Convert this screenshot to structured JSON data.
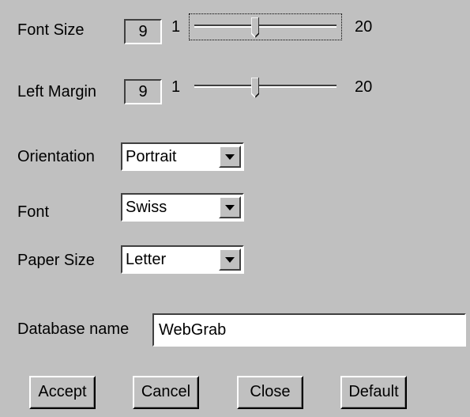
{
  "font_size": {
    "label": "Font Size",
    "value": "9",
    "min_label": "1",
    "max_label": "20",
    "level": 9,
    "min": 1,
    "max": 20
  },
  "left_margin": {
    "label": "Left Margin",
    "value": "9",
    "min_label": "1",
    "max_label": "20",
    "level": 9,
    "min": 1,
    "max": 20
  },
  "orientation": {
    "label": "Orientation",
    "selected": "Portrait"
  },
  "font": {
    "label": "Font",
    "selected": "Swiss"
  },
  "paper_size": {
    "label": "Paper Size",
    "selected": "Letter"
  },
  "database": {
    "label": "Database name",
    "value": "WebGrab"
  },
  "buttons": {
    "accept": "Accept",
    "cancel": "Cancel",
    "close": "Close",
    "default": "Default"
  },
  "icons": {
    "dropdown": "chevron-down-icon",
    "slider_thumb": "slider-thumb-icon"
  }
}
